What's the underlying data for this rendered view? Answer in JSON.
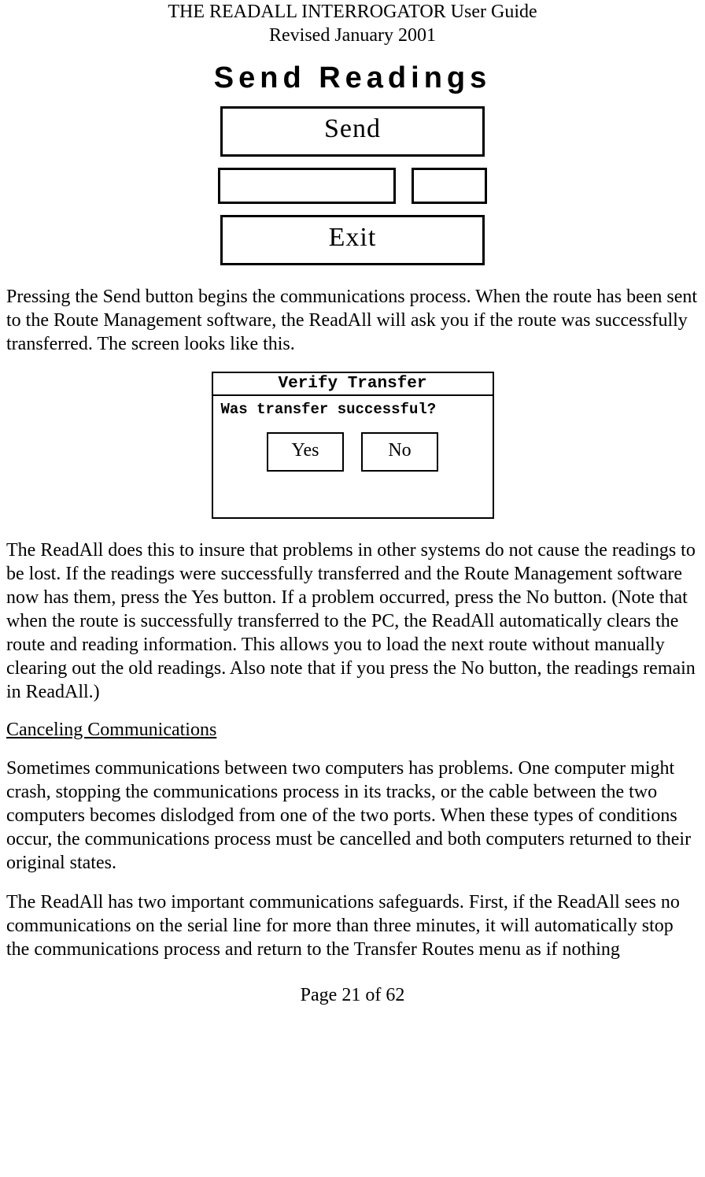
{
  "header": {
    "title": "THE READALL INTERROGATOR User Guide",
    "revised": "Revised January 2001"
  },
  "screen1": {
    "title": "Send Readings",
    "send_label": "Send",
    "exit_label": "Exit"
  },
  "para1": "Pressing the Send button begins the communications process.  When the route has been sent to the Route Management software, the ReadAll will ask you if the route was successfully transferred.  The screen looks like this.",
  "screen2": {
    "title": "Verify Transfer",
    "prompt": "Was transfer successful?",
    "yes_label": "Yes",
    "no_label": "No"
  },
  "para2": "The ReadAll does this to insure that problems in other systems do not cause the readings to be lost.  If the readings were successfully transferred and the Route Management software now has them, press the Yes button.  If a problem occurred, press the No button.  (Note that when the route is successfully transferred to the PC, the ReadAll automatically clears the route and reading information.  This allows you to load the next route without manually clearing out the old readings.  Also note that if you press the No button, the readings remain in ReadAll.)",
  "section_heading": "Canceling Communications",
  "para3": "Sometimes communications between two computers has problems.  One computer might crash, stopping the communications process in its tracks, or the cable between the two computers becomes dislodged from one of the two ports.  When these types of conditions occur, the communications process must be cancelled and both computers returned to their original states.",
  "para4": "The ReadAll has two important communications safeguards.  First, if the ReadAll sees no communications on the serial line for more than three minutes, it will automatically stop the communications process and return to the Transfer Routes menu as if nothing",
  "footer": {
    "page": "Page 21 of 62"
  }
}
